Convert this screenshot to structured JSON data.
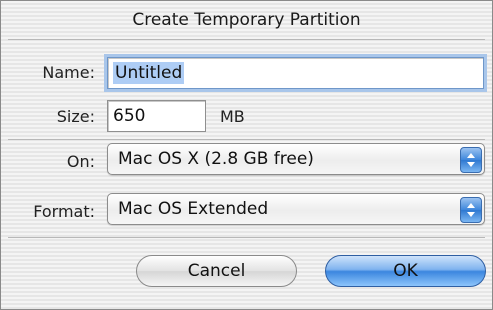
{
  "dialog": {
    "title": "Create Temporary Partition",
    "name_label": "Name:",
    "name_value": "Untitled",
    "size_label": "Size:",
    "size_value": "650",
    "size_unit": "MB",
    "on_label": "On:",
    "on_value": "Mac OS X  (2.8 GB free)",
    "format_label": "Format:",
    "format_value": "Mac OS Extended",
    "cancel_label": "Cancel",
    "ok_label": "OK"
  },
  "icons": [
    "popup-arrows-icon"
  ],
  "colors": {
    "accent": "#3b86df",
    "selection": "#aecdf5"
  }
}
